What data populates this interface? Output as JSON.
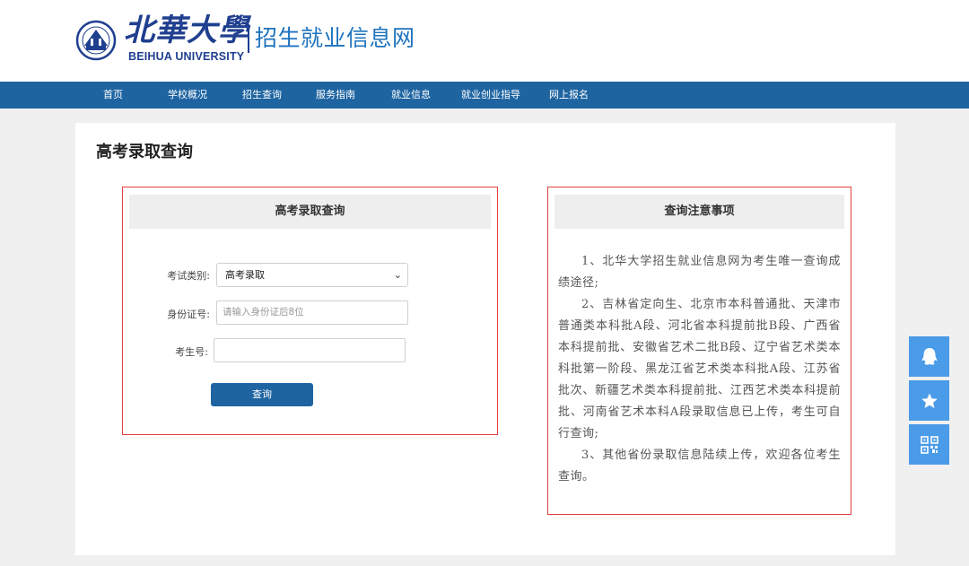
{
  "header": {
    "logo_cn": "北華大學",
    "logo_en": "BEIHUA UNIVERSITY",
    "site_title": "招生就业信息网"
  },
  "nav": {
    "items": [
      {
        "label": "首页"
      },
      {
        "label": "学校概况"
      },
      {
        "label": "招生查询"
      },
      {
        "label": "服务指南"
      },
      {
        "label": "就业信息"
      },
      {
        "label": "就业创业指导"
      },
      {
        "label": "网上报名"
      }
    ]
  },
  "page": {
    "title": "高考录取查询"
  },
  "query": {
    "header": "高考录取查询",
    "exam_type_label": "考试类别:",
    "exam_type_value": "高考录取",
    "id_label": "身份证号:",
    "id_placeholder": "请输入身份证后8位",
    "exam_no_label": "考生号:",
    "exam_no_value": "",
    "submit_label": "查询"
  },
  "notice": {
    "header": "查询注意事项",
    "paragraphs": [
      "1、北华大学招生就业信息网为考生唯一查询成绩途径;",
      "2、吉林省定向生、北京市本科普通批、天津市普通类本科批A段、河北省本科提前批B段、广西省本科提前批、安徽省艺术二批B段、辽宁省艺术类本科批第一阶段、黑龙江省艺术类本科批A段、江苏省批次、新疆艺术类本科提前批、江西艺术类本科提前批、河南省艺术本科A段录取信息已上传，考生可自行查询;",
      "3、其他省份录取信息陆续上传，欢迎各位考生查询。"
    ]
  },
  "float_bar": {
    "icons": [
      "qq-icon",
      "star-icon",
      "qrcode-icon"
    ]
  },
  "colors": {
    "nav_bg": "#1e64a1",
    "brand_blue": "#1e73be",
    "highlight_border": "#e04040",
    "float_bg": "#4a9be8"
  }
}
